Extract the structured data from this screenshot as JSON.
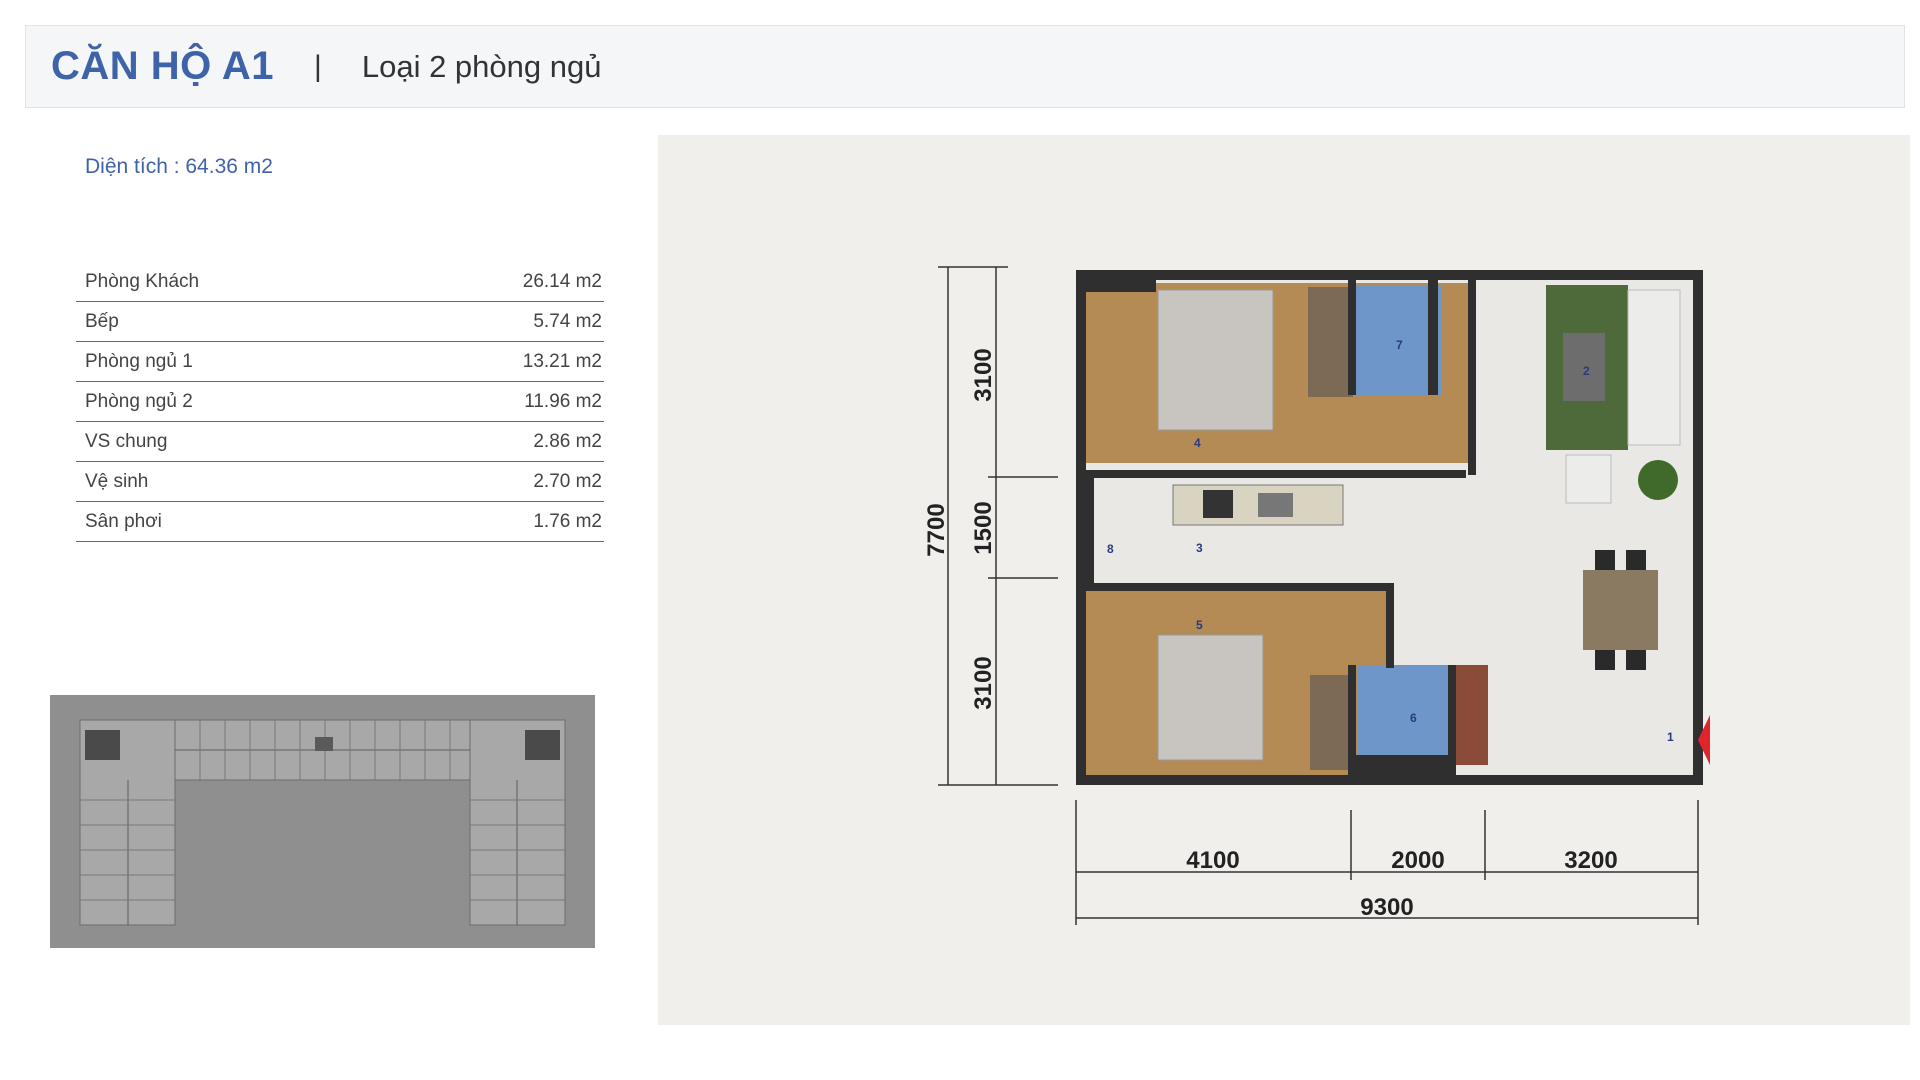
{
  "header": {
    "title": "CĂN HỘ A1",
    "separator": "|",
    "subtitle": "Loại 2 phòng ngủ"
  },
  "area": "Diện tích : 64.36 m2",
  "rooms": [
    {
      "name": "Phòng Khách",
      "value": "26.14 m2"
    },
    {
      "name": "Bếp",
      "value": "5.74 m2"
    },
    {
      "name": "Phòng ngủ 1",
      "value": "13.21 m2"
    },
    {
      "name": "Phòng ngủ 2",
      "value": "11.96 m2"
    },
    {
      "name": "VS chung",
      "value": "2.86 m2"
    },
    {
      "name": "Vệ sinh",
      "value": "2.70 m2"
    },
    {
      "name": "Sân phơi",
      "value": "1.76 m2"
    }
  ],
  "floorplan": {
    "dimensions": {
      "total_height": "7700",
      "segment_top": "3100",
      "segment_mid": "1500",
      "segment_bottom": "3100",
      "width_left": "4100",
      "width_mid": "2000",
      "width_right": "3200",
      "total_width": "9300"
    },
    "room_numbers": [
      "1",
      "2",
      "3",
      "4",
      "5",
      "6",
      "7",
      "8"
    ],
    "colors": {
      "wall": "#2f2f2f",
      "wood_floor": "#b48a55",
      "tile_floor": "#6f96c8",
      "living_floor": "#e9e8e4",
      "rug": "#4f6a3a",
      "entrance_arrow": "#e0242a"
    }
  }
}
